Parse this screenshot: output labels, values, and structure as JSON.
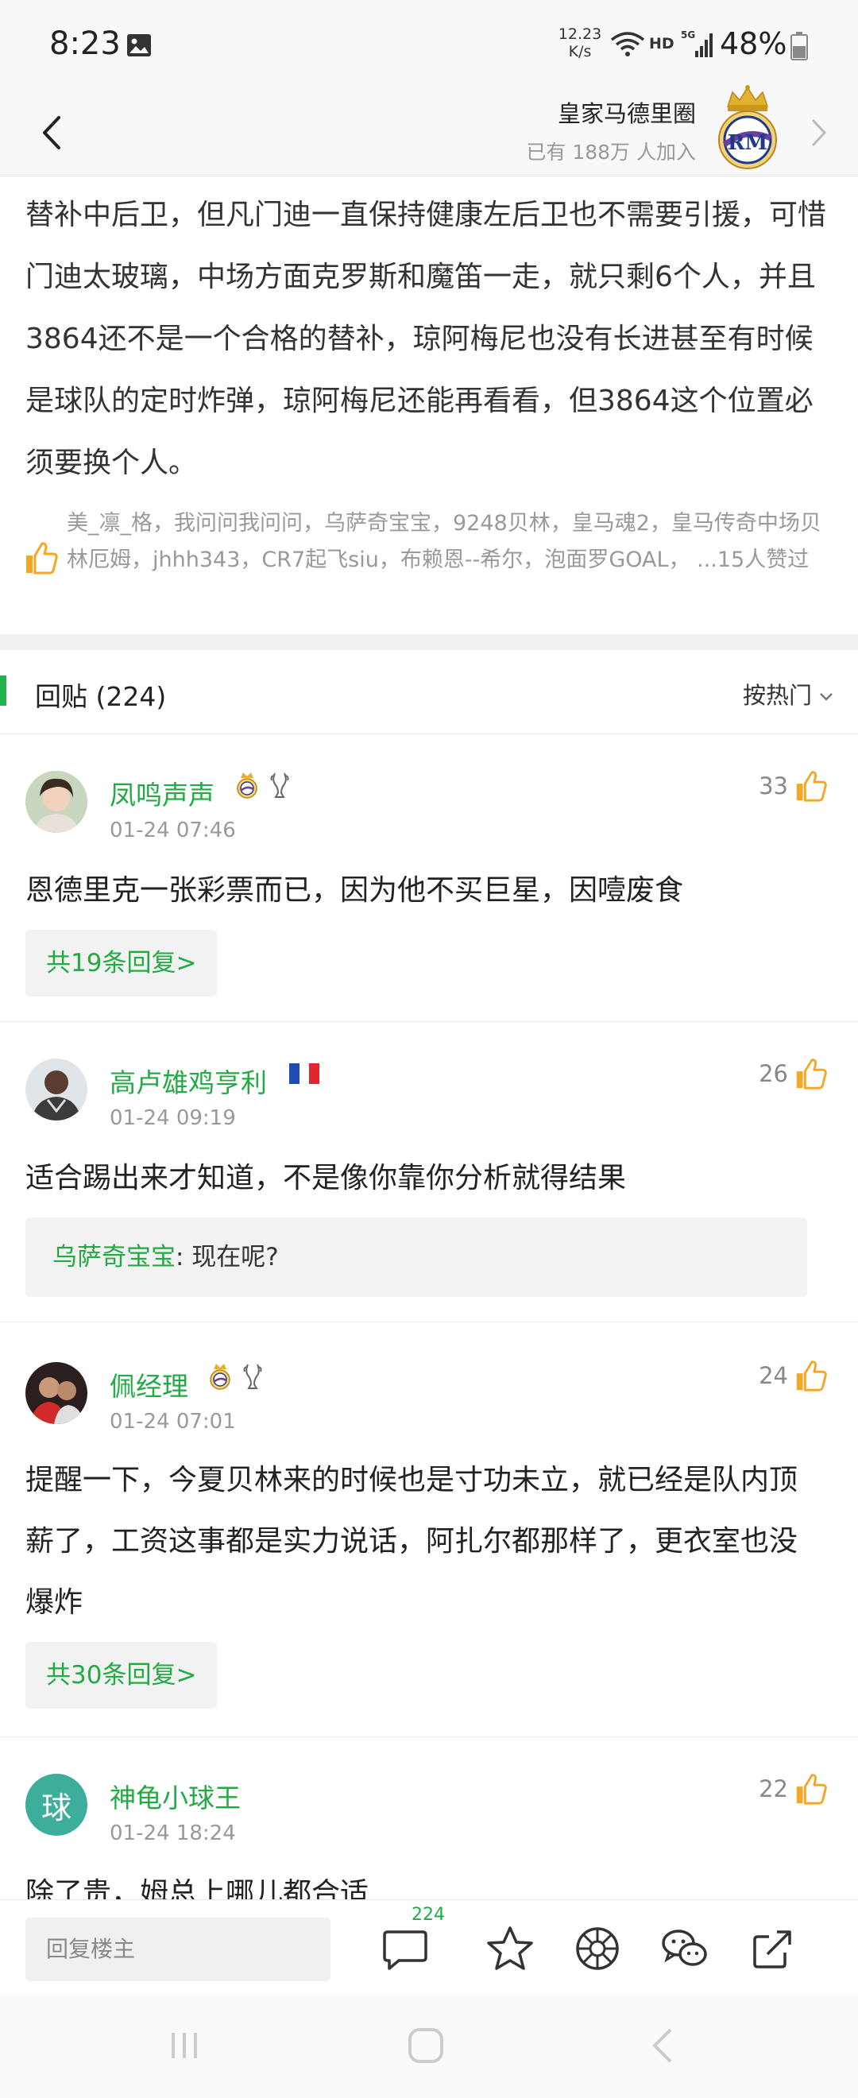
{
  "status_bar": {
    "time": "8:23",
    "net_speed_value": "12.23",
    "net_speed_unit": "K/s",
    "hd": "HD",
    "network": "5G",
    "battery": "48%"
  },
  "header": {
    "circle_name": "皇家马德里圈",
    "members": "已有 188万 人加入"
  },
  "post": {
    "text": "替补中后卫，但凡门迪一直保持健康左后卫也不需要引援，可惜门迪太玻璃，中场方面克罗斯和魔笛一走，就只剩6个人，并且3864还不是一个合格的替补，琼阿梅尼也没有长进甚至有时候是球队的定时炸弹，琼阿梅尼还能再看看，但3864这个位置必须要换个人。",
    "likers": "美_凛_格，我问问我问问，乌萨奇宝宝，9248贝林，皇马魂2，皇马传奇中场贝林厄姆，jhhh343，CR7起飞siu，布赖恩--希尔，泡面罗GOAL， ...15人赞过"
  },
  "replies": {
    "title": "回贴 (224)",
    "sort": "按热门"
  },
  "comments": [
    {
      "user": "凤鸣声声",
      "time": "01-24 07:46",
      "likes": "33",
      "text": "恩德里克一张彩票而已，因为他不买巨星，因噎废食",
      "more": "共19条回复>"
    },
    {
      "user": "高卢雄鸡亨利",
      "time": "01-24 09:19",
      "likes": "26",
      "text": "适合踢出来才知道，不是像你靠你分析就得结果",
      "quote_user": "乌萨奇宝宝",
      "quote_text": ": 现在呢?"
    },
    {
      "user": "佩经理",
      "time": "01-24 07:01",
      "likes": "24",
      "text": "提醒一下，今夏贝林来的时候也是寸功未立，就已经是队内顶薪了，工资这事都是实力说话，阿扎尔都那样了，更衣室也没爆炸",
      "more": "共30条回复>"
    },
    {
      "user": "神龟小球王",
      "avatar_char": "球",
      "time": "01-24 18:24",
      "likes": "22",
      "text": "除了贵，姆总上哪儿都合适"
    }
  ],
  "bottom_bar": {
    "reply_placeholder": "回复楼主",
    "comment_count": "224"
  },
  "colors": {
    "accent_green": "#22aa44",
    "like_orange": "#f5a623",
    "avatar_teal": "#3dae9c"
  }
}
